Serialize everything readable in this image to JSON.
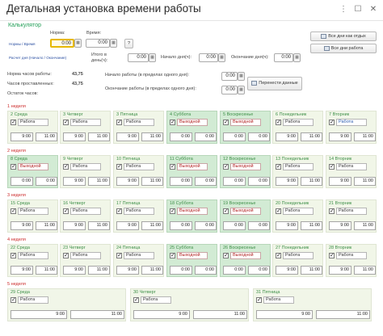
{
  "window": {
    "title": "Детальная установка времени работы",
    "menu_glyph": "⋮",
    "max_glyph": "☐",
    "close_glyph": "✕"
  },
  "calc": {
    "title": "Калькулятор",
    "norm_label": "Норма:",
    "time_label": "Время:",
    "link_norms": "Нормы / Время",
    "link_range": "Расчет дня (Начало / Окончание)",
    "norm_value": "0:00",
    "time_value": "0:00",
    "help_glyph": "?",
    "total_label_1": "Итого в",
    "total_label_2": "день(ч):",
    "total_value": "0:00",
    "start_label": "Начало дня(ч):",
    "start_value": "0:00",
    "end_label": "Окончание дня(ч):",
    "end_value": "0:00",
    "btn_all_days": "Все дни как отдых",
    "btn_work_all": "Все дни работа",
    "norm_hours_label": "Норма часов работы:",
    "norm_hours_value": "43,75",
    "hours_spent_label": "Часов проставленных:",
    "hours_spent_value": "43,75",
    "remaining_label": "Остаток часов:",
    "work_start_label": "Начало работы (в пределах одного дня):",
    "work_start_value": "0:00",
    "work_end_label": "Окончание работы (в пределах одного дня):",
    "work_end_value": "0:00",
    "transfer_btn": "Перенести данные"
  },
  "weeks": [
    {
      "label": "1 неделя",
      "days": [
        {
          "name": "2 Среда",
          "status": "Работа",
          "start": "9:00",
          "end": "11:00",
          "weekend": false
        },
        {
          "name": "3 Четверг",
          "status": "Работа",
          "start": "9:00",
          "end": "11:00",
          "weekend": false
        },
        {
          "name": "3 Пятница",
          "status": "Работа",
          "start": "9:00",
          "end": "11:00",
          "weekend": false
        },
        {
          "name": "4 Суббота",
          "status": "Выходной",
          "start": "0:00",
          "end": "0:00",
          "weekend": true
        },
        {
          "name": "5 Воскресенье",
          "status": "Выходной",
          "start": "0:00",
          "end": "0:00",
          "weekend": true
        },
        {
          "name": "6 Понедельник",
          "status": "Работа",
          "start": "9:00",
          "end": "11:00",
          "weekend": false
        },
        {
          "name": "7 Вторник",
          "status": "Работа",
          "start": "9:00",
          "end": "11:00",
          "weekend": false
        }
      ]
    },
    {
      "label": "2 неделя",
      "days": [
        {
          "name": "8 Среда",
          "status": "Выходной",
          "start": "0:00",
          "end": "0:00",
          "weekend": true
        },
        {
          "name": "9 Четверг",
          "status": "Работа",
          "start": "9:00",
          "end": "11:00",
          "weekend": false
        },
        {
          "name": "10 Пятница",
          "status": "Работа",
          "start": "9:00",
          "end": "11:00",
          "weekend": false
        },
        {
          "name": "11 Суббота",
          "status": "Выходной",
          "start": "0:00",
          "end": "0:00",
          "weekend": true
        },
        {
          "name": "12 Воскресенье",
          "status": "Выходной",
          "start": "0:00",
          "end": "0:00",
          "weekend": true
        },
        {
          "name": "13 Понедельник",
          "status": "Работа",
          "start": "9:00",
          "end": "11:00",
          "weekend": false
        },
        {
          "name": "14 Вторник",
          "status": "Работа",
          "start": "9:00",
          "end": "11:00",
          "weekend": false
        }
      ]
    },
    {
      "label": "3 неделя",
      "days": [
        {
          "name": "15 Среда",
          "status": "Работа",
          "start": "9:00",
          "end": "11:00",
          "weekend": false
        },
        {
          "name": "16 Четверг",
          "status": "Работа",
          "start": "9:00",
          "end": "11:00",
          "weekend": false
        },
        {
          "name": "17 Пятница",
          "status": "Работа",
          "start": "9:00",
          "end": "11:00",
          "weekend": false
        },
        {
          "name": "18 Суббота",
          "status": "Выходной",
          "start": "0:00",
          "end": "0:00",
          "weekend": true
        },
        {
          "name": "19 Воскресенье",
          "status": "Выходной",
          "start": "0:00",
          "end": "0:00",
          "weekend": true
        },
        {
          "name": "20 Понедельник",
          "status": "Работа",
          "start": "9:00",
          "end": "11:00",
          "weekend": false
        },
        {
          "name": "21 Вторник",
          "status": "Работа",
          "start": "9:00",
          "end": "11:00",
          "weekend": false
        }
      ]
    },
    {
      "label": "4 неделя",
      "days": [
        {
          "name": "22 Среда",
          "status": "Работа",
          "start": "9:00",
          "end": "11:00",
          "weekend": false
        },
        {
          "name": "23 Четверг",
          "status": "Работа",
          "start": "9:00",
          "end": "11:00",
          "weekend": false
        },
        {
          "name": "24 Пятница",
          "status": "Работа",
          "start": "9:00",
          "end": "11:00",
          "weekend": false
        },
        {
          "name": "25 Суббота",
          "status": "Выходной",
          "start": "0:00",
          "end": "0:00",
          "weekend": true
        },
        {
          "name": "26 Воскресенье",
          "status": "Выходной",
          "start": "0:00",
          "end": "0:00",
          "weekend": true
        },
        {
          "name": "27 Понедельник",
          "status": "Работа",
          "start": "9:00",
          "end": "11:00",
          "weekend": false
        },
        {
          "name": "28 Вторник",
          "status": "Работа",
          "start": "9:00",
          "end": "11:00",
          "weekend": false
        }
      ]
    },
    {
      "label": "5 неделя",
      "days": [
        {
          "name": "29 Среда",
          "status": "Работа",
          "start": "9:00",
          "end": "11:00",
          "weekend": false
        },
        {
          "name": "30 Четверг",
          "status": "Работа",
          "start": "9:00",
          "end": "11:00",
          "weekend": false
        },
        {
          "name": "31 Пятница",
          "status": "Работа",
          "start": "9:00",
          "end": "11:00",
          "weekend": false
        }
      ]
    }
  ]
}
